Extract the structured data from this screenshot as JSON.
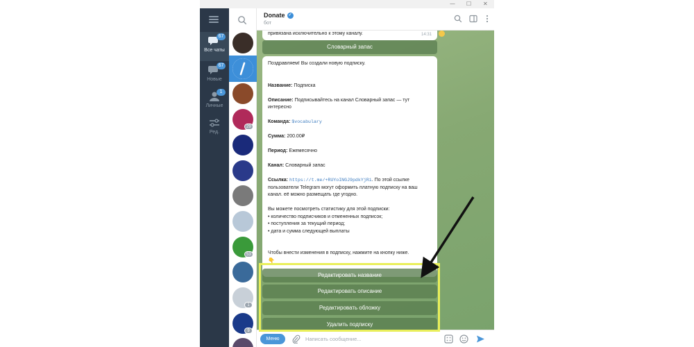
{
  "header": {
    "title": "Donate",
    "subtitle": "бот"
  },
  "folders": [
    {
      "label": "Все чаты",
      "badge": "67",
      "icon": "chats-icon"
    },
    {
      "label": "Новые",
      "badge": "67",
      "icon": "new-chats-icon"
    },
    {
      "label": "Личные",
      "badge": "1",
      "icon": "personal-icon"
    },
    {
      "label": "Ред.",
      "badge": "",
      "icon": "edit-folders-icon"
    }
  ],
  "chat_avatars": [
    {
      "name": "avatar-channel-1",
      "badge": "",
      "color": "#3a2e28"
    },
    {
      "name": "avatar-donate",
      "badge": "",
      "color": "#3d8fd9"
    },
    {
      "name": "avatar-channel-3",
      "badge": "",
      "color": "#8a4a2a"
    },
    {
      "name": "avatar-channel-4",
      "badge": "29",
      "color": "#b02a5a"
    },
    {
      "name": "avatar-channel-5",
      "badge": "",
      "color": "#1a2a7a"
    },
    {
      "name": "avatar-channel-6",
      "badge": "",
      "color": "#2a3a8a"
    },
    {
      "name": "avatar-channel-7",
      "badge": "",
      "color": "#7a7a7a"
    },
    {
      "name": "avatar-channel-8",
      "badge": "",
      "color": "#b8c8d8"
    },
    {
      "name": "avatar-channel-9",
      "badge": "53",
      "color": "#3a9a3a"
    },
    {
      "name": "avatar-channel-10",
      "badge": "",
      "color": "#3a6a9a"
    },
    {
      "name": "avatar-channel-11",
      "badge": "1",
      "color": "#c8d0d8"
    },
    {
      "name": "avatar-channel-12",
      "badge": "9",
      "color": "#1a3a8a"
    },
    {
      "name": "avatar-channel-13",
      "badge": "",
      "color": "#5a4a6a"
    }
  ],
  "messages": {
    "prev_text": "привязана исключительно к этому каналу.",
    "prev_time": "14:31",
    "prev_button": "Словарный запас",
    "bubble": {
      "greeting": "Поздравляем! Вы создали новую подписку.",
      "name_label": "Название:",
      "name_value": "Подписка",
      "desc_label": "Описание:",
      "desc_value": "Подписывайтесь на канал Словарный запас — тут интересно",
      "cmd_label": "Команда:",
      "cmd_value": "$vocabulary",
      "sum_label": "Сумма:",
      "sum_value": "200.00₽",
      "period_label": "Период:",
      "period_value": "Ежемесячно",
      "channel_label": "Канал:",
      "channel_value": "Словарный запас",
      "link_label": "Ссылка:",
      "link_value": "https://t.me/+RUYoINGJ9pdkYjRi",
      "link_note": ". По этой ссылке пользователи Telegram могут оформить платную подписку на ваш канал. её можно размещать где угодно.",
      "stats_intro": "Вы можете посмотреть статистику для этой подписки:",
      "stats_1": "• количество подписчиков и отмененных подписок;",
      "stats_2": "• поступления за текущий период;",
      "stats_3": "• дата и сумма следующей выплаты",
      "edit_note": "Чтобы внести изменения в подписку, нажмите на кнопку ниже."
    },
    "buttons": [
      "Редактировать название",
      "Редактировать описание",
      "Редактировать обложку",
      "Удалить подписку"
    ]
  },
  "composer": {
    "menu_label": "Меню",
    "placeholder": "Написать сообщение..."
  },
  "colors": {
    "accent": "#3d8fd9",
    "rail": "#2b3848",
    "chat_bg": "#8aab77",
    "highlight": "#e9ef5a",
    "arrow": "#111111"
  }
}
